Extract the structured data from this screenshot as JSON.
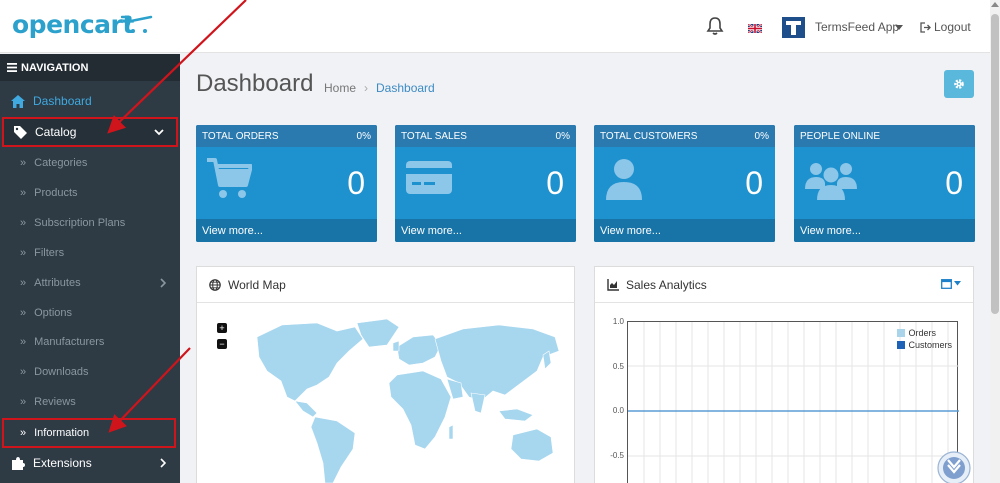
{
  "header": {
    "logo_text": "opencart",
    "user_name": "TermsFeed App",
    "logout_label": "Logout"
  },
  "sidebar": {
    "title": "NAVIGATION",
    "dashboard": "Dashboard",
    "catalog": "Catalog",
    "items": [
      {
        "label": "Categories",
        "has_sub": false
      },
      {
        "label": "Products",
        "has_sub": false
      },
      {
        "label": "Subscription Plans",
        "has_sub": false
      },
      {
        "label": "Filters",
        "has_sub": false
      },
      {
        "label": "Attributes",
        "has_sub": true
      },
      {
        "label": "Options",
        "has_sub": false
      },
      {
        "label": "Manufacturers",
        "has_sub": false
      },
      {
        "label": "Downloads",
        "has_sub": false
      },
      {
        "label": "Reviews",
        "has_sub": false
      },
      {
        "label": "Information",
        "has_sub": false
      }
    ],
    "extensions": "Extensions"
  },
  "page": {
    "title": "Dashboard",
    "breadcrumb_home": "Home",
    "breadcrumb_current": "Dashboard"
  },
  "tiles": [
    {
      "title": "TOTAL ORDERS",
      "percent": "0%",
      "value": "0",
      "link": "View more...",
      "icon": "cart-icon"
    },
    {
      "title": "TOTAL SALES",
      "percent": "0%",
      "value": "0",
      "link": "View more...",
      "icon": "credit-card-icon"
    },
    {
      "title": "TOTAL CUSTOMERS",
      "percent": "0%",
      "value": "0",
      "link": "View more...",
      "icon": "user-icon"
    },
    {
      "title": "PEOPLE ONLINE",
      "percent": "",
      "value": "0",
      "link": "View more...",
      "icon": "users-icon"
    }
  ],
  "world_map": {
    "title": "World Map",
    "zoom_in": "+",
    "zoom_out": "−"
  },
  "sales_analytics": {
    "title": "Sales Analytics",
    "legend": [
      "Orders",
      "Customers"
    ],
    "y_ticks": [
      "1.0",
      "0.5",
      "0.0",
      "-0.5"
    ]
  },
  "colors": {
    "brand": "#2ba1cc",
    "sidebar_bg": "#2e3a44",
    "tile_bg": "#1e91cf",
    "highlight_red": "#d0141c",
    "orders_legend": "#a9d4ea",
    "customers_legend": "#1e62b8",
    "map_land": "#a7d6ef"
  }
}
